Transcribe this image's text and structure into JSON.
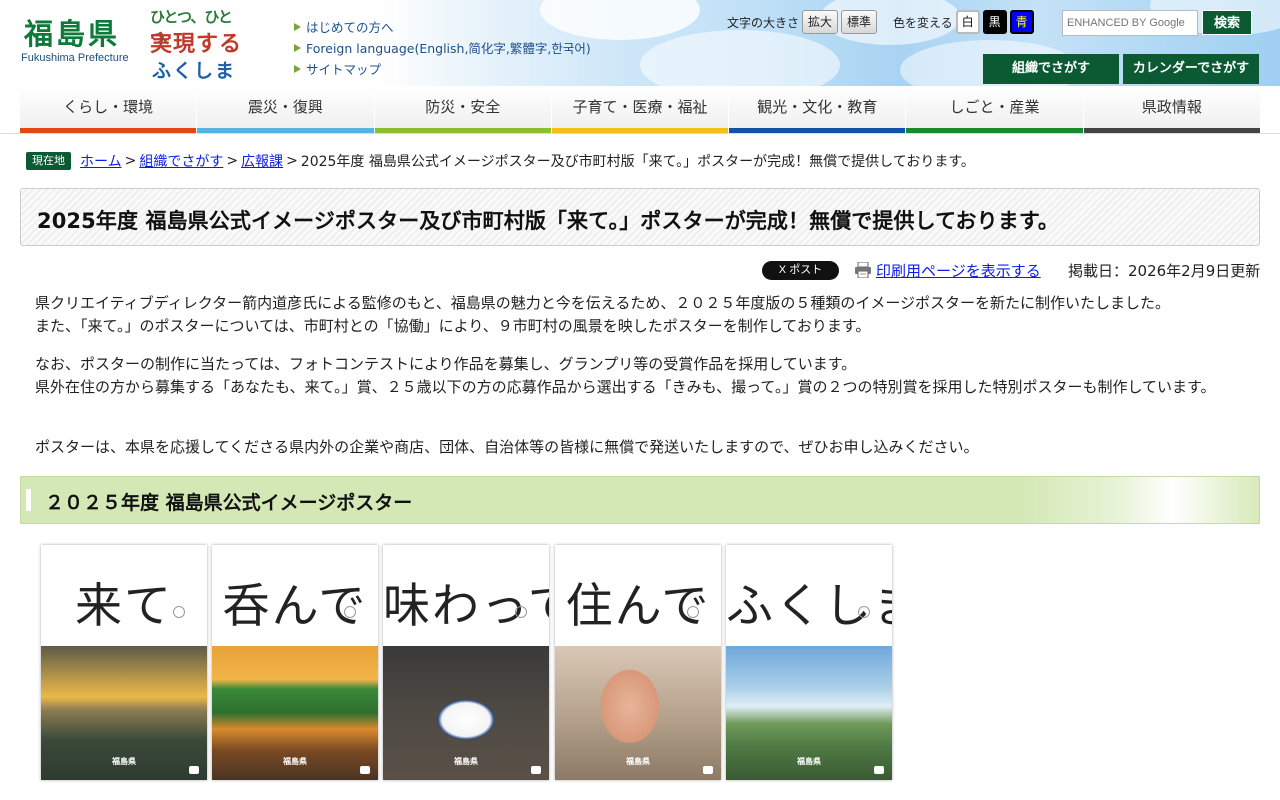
{
  "header": {
    "logo_kanji": "福島県",
    "logo_roman": "Fukushima Prefecture",
    "slogan_lines": [
      "ひとつ、ひとつ、",
      "実現する",
      "ふくしま"
    ],
    "links": [
      "はじめての方へ",
      "Foreign language(English,简化字,繁體字,한국어)",
      "サイトマップ"
    ],
    "font_size_label": "文字の大きさ",
    "font_size_buttons": [
      "拡大",
      "標準"
    ],
    "color_label": "色を変える",
    "color_buttons": [
      {
        "label": "白",
        "bg": "#ffffff",
        "fg": "#111111"
      },
      {
        "label": "黒",
        "bg": "#000000",
        "fg": "#ffffff"
      },
      {
        "label": "青",
        "bg": "#0000ff",
        "fg": "#ffff00"
      }
    ],
    "search_placeholder": "ENHANCED BY Google",
    "search_button": "検索",
    "org_button": "組織でさがす",
    "calendar_button": "カレンダーでさがす",
    "brand_green": "#0b5a34"
  },
  "nav": [
    {
      "label": "くらし・環境",
      "color": "#e04a12"
    },
    {
      "label": "震災・復興",
      "color": "#56b4e0"
    },
    {
      "label": "防災・安全",
      "color": "#8cbd2a"
    },
    {
      "label": "子育て・医療・福祉",
      "color": "#f0c018"
    },
    {
      "label": "観光・文化・教育",
      "color": "#1450a8"
    },
    {
      "label": "しごと・産業",
      "color": "#168a2c"
    },
    {
      "label": "県政情報",
      "color": "#444444"
    }
  ],
  "breadcrumb": {
    "badge": "現在地",
    "links": [
      "ホーム",
      "組織でさがす",
      "広報課"
    ],
    "current": "2025年度 福島県公式イメージポスター及び市町村版「来て。」ポスターが完成！無償で提供しております。"
  },
  "page": {
    "title": "2025年度 福島県公式イメージポスター及び市町村版「来て。」ポスターが完成！無償で提供しております。",
    "xpost_label": "X ポスト",
    "print_label": "印刷用ページを表示する",
    "updated": "掲載日：2026年2月9日更新",
    "paragraphs": [
      "　県クリエイティブディレクター箭内道彦氏による監修のもと、福島県の魅力と今を伝えるため、２０２５年度版の５種類のイメージポスターを新たに制作いたしました。\n　また、「来て。」のポスターについては、市町村との「協働」により、９市町村の風景を映したポスターを制作しております。",
      "　なお、ポスターの制作に当たっては、フォトコンテストにより作品を募集し、グランプリ等の受賞作品を採用しています。\n　県外在住の方から募集する「あなたも、来て。」賞、２５歳以下の方の応募作品から選出する「きみも、撮って。」賞の２つの特別賞を採用した特別ポスターも制作しています。",
      "　ポスターは、本県を応援してくださる県内外の企業や商店、団体、自治体等の皆様に無償で発送いたしますので、ぜひお申し込みください。"
    ],
    "section_title": "２０２５年度 福島県公式イメージポスター"
  },
  "posters": [
    {
      "word": "来て",
      "label": "福島県"
    },
    {
      "word": "呑んで",
      "label": "福島県"
    },
    {
      "word": "味わって",
      "label": "福島県"
    },
    {
      "word": "住んで",
      "label": "福島県"
    },
    {
      "word": "ふくしま",
      "label": "福島県"
    }
  ]
}
